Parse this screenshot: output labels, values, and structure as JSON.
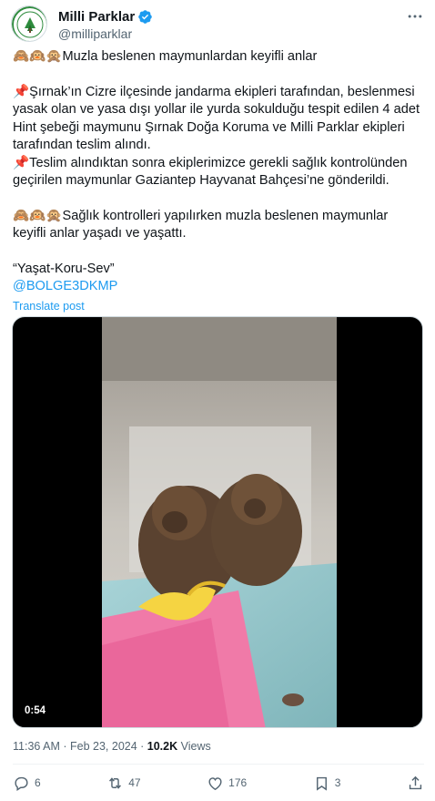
{
  "author": {
    "display_name": "Milli Parklar",
    "handle": "@milliparklar",
    "verified": true
  },
  "tweet": {
    "lines": [
      "🙈🙉🙊Muzla beslenen maymunlardan keyifli anlar",
      "",
      "📌Şırnak’ın Cizre ilçesinde jandarma ekipleri tarafından, beslenmesi yasak olan ve yasa dışı yollar ile yurda sokulduğu tespit edilen 4 adet Hint şebeği maymunu Şırnak Doğa Koruma ve Milli Parklar ekipleri tarafından teslim alındı.",
      "📌Teslim alındıktan sonra ekiplerimizce gerekli sağlık kontrolünden geçirilen maymunlar Gaziantep Hayvanat Bahçesi’ne gönderildi.",
      "",
      "🙈🙉🙊Sağlık kontrolleri yapılırken muzla beslenen maymunlar keyifli anlar yaşadı ve yaşattı.",
      "",
      "“Yaşat-Koru-Sev”"
    ],
    "mention": "@BOLGE3DKMP",
    "translate_label": "Translate post"
  },
  "media": {
    "duration": "0:54"
  },
  "meta": {
    "time": "11:36 AM",
    "separator": " · ",
    "date": "Feb 23, 2024",
    "views_count": "10.2K",
    "views_label": " Views"
  },
  "actions": {
    "replies": "6",
    "reposts": "47",
    "likes": "176",
    "bookmarks": "3"
  },
  "colors": {
    "accent": "#1d9bf0",
    "text": "#0f1419",
    "secondary": "#536471"
  },
  "icons": [
    "more-icon",
    "verified-icon",
    "reply-icon",
    "repost-icon",
    "like-icon",
    "bookmark-icon",
    "share-icon"
  ]
}
